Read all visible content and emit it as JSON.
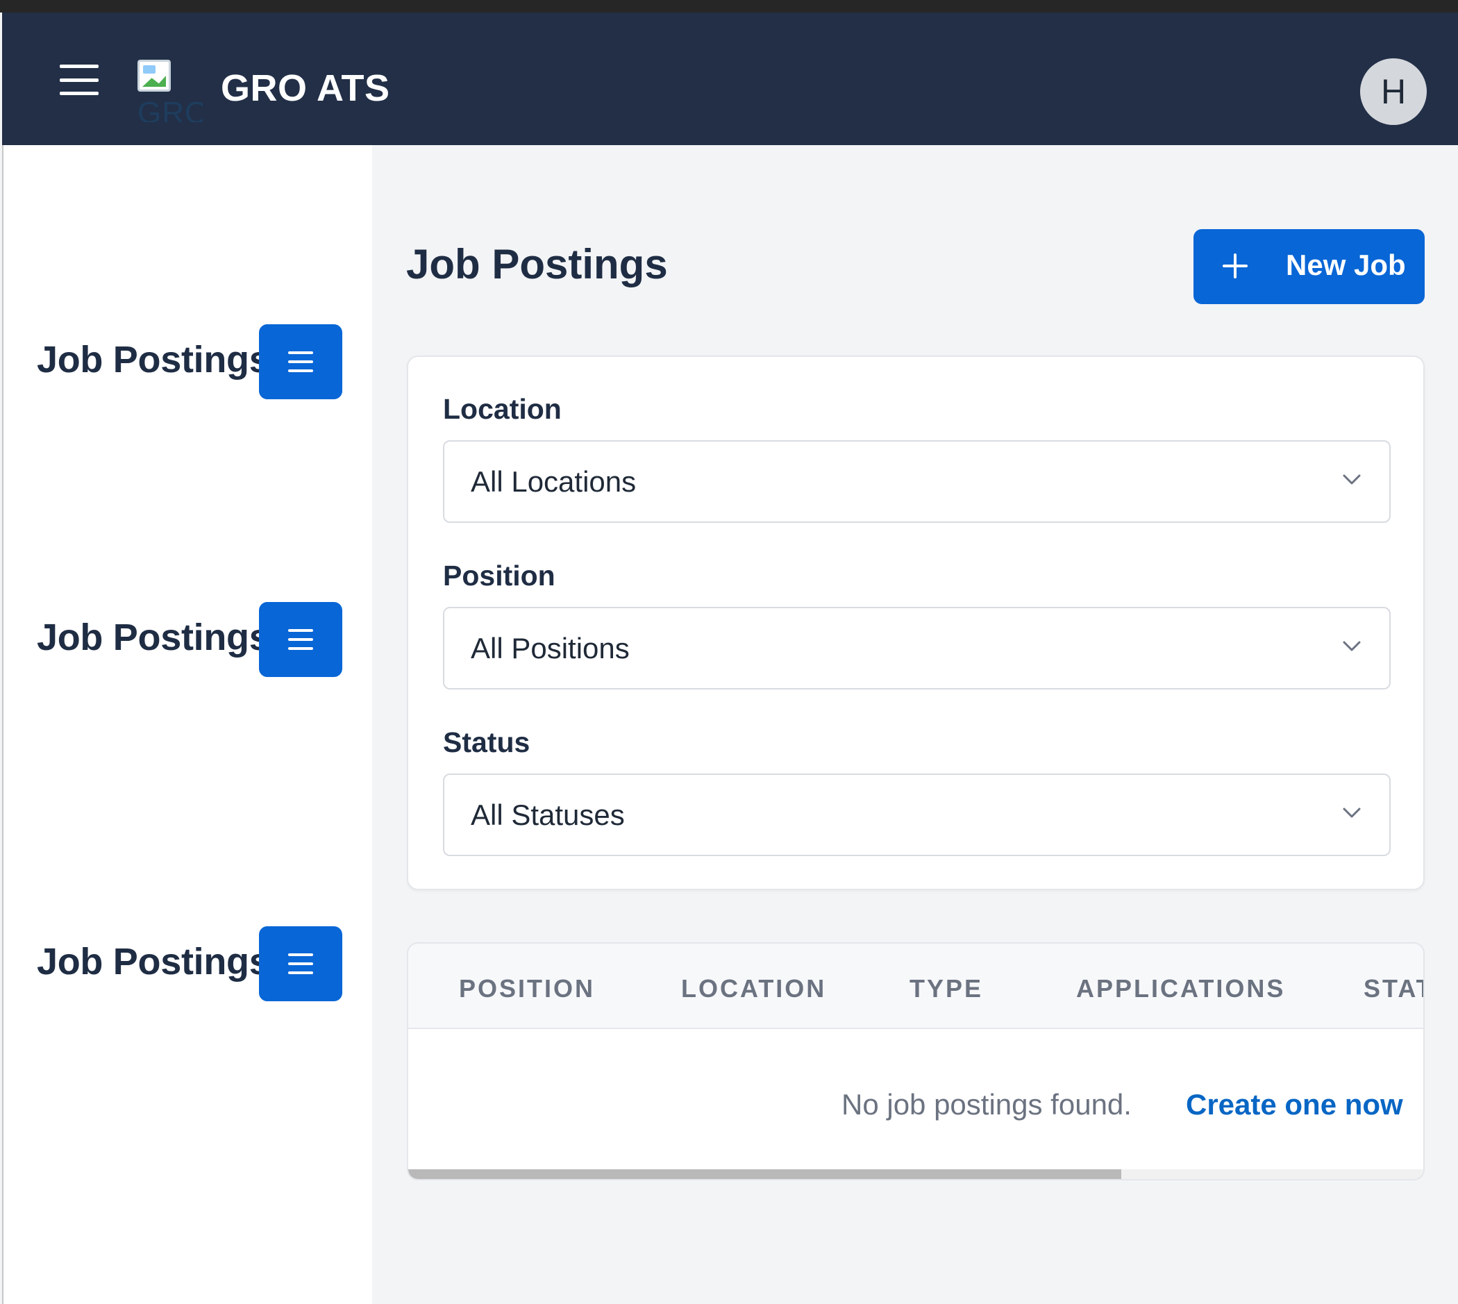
{
  "header": {
    "menu_icon": "hamburger-icon",
    "logo_alt": "GRO",
    "app_title": "GRO ATS",
    "avatar_initial": "H",
    "background": "#222f47"
  },
  "sidebar": {
    "items": [
      {
        "label": "Job Postings",
        "button_icon": "menu-icon"
      },
      {
        "label": "Job Postings",
        "button_icon": "menu-icon"
      },
      {
        "label": "Job Postings",
        "button_icon": "menu-icon"
      }
    ]
  },
  "main": {
    "title": "Job Postings",
    "new_job_label": "New Job",
    "new_job_icon": "plus-icon",
    "accent": "#0866d6"
  },
  "filters": {
    "location": {
      "label": "Location",
      "value": "All Locations"
    },
    "position": {
      "label": "Position",
      "value": "All Positions"
    },
    "status": {
      "label": "Status",
      "value": "All Statuses"
    }
  },
  "table": {
    "columns": [
      "POSITION",
      "LOCATION",
      "TYPE",
      "APPLICATIONS",
      "STAT"
    ],
    "empty_text": "No job postings found.",
    "empty_link": "Create one now"
  }
}
